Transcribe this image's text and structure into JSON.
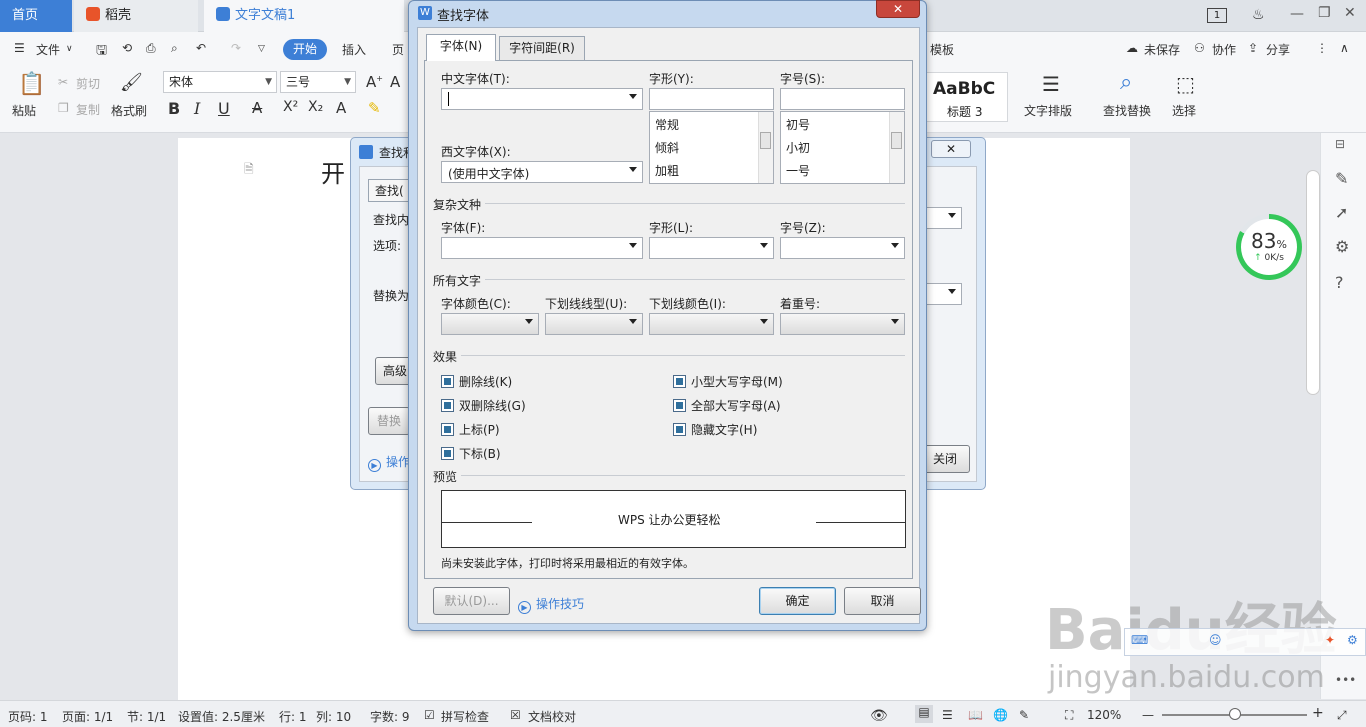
{
  "tabs": {
    "home": "首页",
    "daoke": "稻壳",
    "doc": "文字文稿1"
  },
  "menu": {
    "file": "文件",
    "start": "开始",
    "insert": "插入",
    "page": "页",
    "template": "模板",
    "unsaved": "未保存",
    "collab": "协作",
    "share": "分享"
  },
  "ribbon": {
    "paste": "粘贴",
    "cut": "剪切",
    "copy": "复制",
    "format_painter": "格式刷",
    "font_name": "宋体",
    "font_size": "三号",
    "style_preview": "AaBbC",
    "style_name": "标题 3",
    "text_layout": "文字排版",
    "find_replace": "查找替换",
    "select": "选择"
  },
  "document": {
    "visible_text": "开"
  },
  "bg_dialog": {
    "title": "查找和",
    "tab": "查找(",
    "find_label": "查找内",
    "options_label": "选项:",
    "replace_label": "替换为",
    "advanced": "高级",
    "replace_btn": "替换",
    "tips": "操作",
    "close": "关闭"
  },
  "dialog": {
    "title": "查找字体",
    "tab_font": "字体(N)",
    "tab_spacing": "字符间距(R)",
    "cn_font_label": "中文字体(T):",
    "cn_font_value": "",
    "style_label": "字形(Y):",
    "size_label": "字号(S):",
    "style_items": [
      "常规",
      "倾斜",
      "加粗"
    ],
    "size_items": [
      "初号",
      "小初",
      "一号"
    ],
    "west_font_label": "西文字体(X):",
    "west_font_value": "(使用中文字体)",
    "complex_section": "复杂文种",
    "complex_font_label": "字体(F):",
    "complex_style_label": "字形(L):",
    "complex_size_label": "字号(Z):",
    "all_text_section": "所有文字",
    "color_label": "字体颜色(C):",
    "underline_type_label": "下划线线型(U):",
    "underline_color_label": "下划线颜色(I):",
    "emphasis_label": "着重号:",
    "effects_section": "效果",
    "effects_left": [
      "删除线(K)",
      "双删除线(G)",
      "上标(P)",
      "下标(B)"
    ],
    "effects_right": [
      "小型大写字母(M)",
      "全部大写字母(A)",
      "隐藏文字(H)"
    ],
    "preview_section": "预览",
    "preview_text": "WPS 让办公更轻松",
    "note": "尚未安装此字体，打印时将采用最相近的有效字体。",
    "default_btn": "默认(D)...",
    "tips": "操作技巧",
    "ok": "确定",
    "cancel": "取消"
  },
  "speed": {
    "percent": "83",
    "unit": "%",
    "rate": "0K/s"
  },
  "status": {
    "page_code": "页码: 1",
    "page": "页面: 1/1",
    "section": "节: 1/1",
    "settings": "设置值: 2.5厘米",
    "row": "行: 1",
    "col": "列: 10",
    "words": "字数: 9",
    "spell": "拼写检查",
    "proof": "文档校对",
    "zoom": "120%"
  },
  "watermark": {
    "brand": "Baidu经验",
    "url": "jingyan.baidu.com"
  },
  "colors": {
    "accent": "#3d7fd6",
    "dialog_frame": "#c6d9ef",
    "close_red": "#c8473c",
    "speed_green": "#34c759"
  }
}
